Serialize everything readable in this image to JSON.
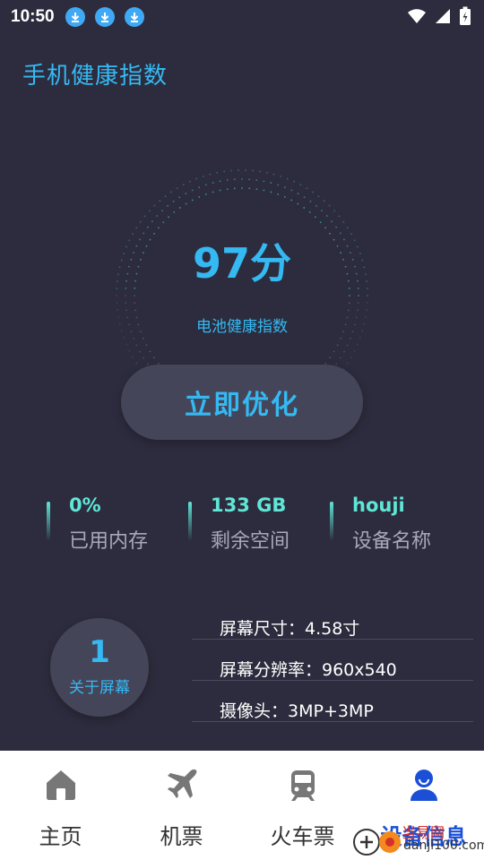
{
  "status": {
    "time": "10:50"
  },
  "header": {
    "title": "手机健康指数"
  },
  "score": {
    "value": "97分",
    "label": "电池健康指数"
  },
  "optimize_label": "立即优化",
  "stats": [
    {
      "value": "0%",
      "label": "已用内存"
    },
    {
      "value": "133 GB",
      "label": "剩余空间"
    },
    {
      "value": "houji",
      "label": "设备名称"
    }
  ],
  "screen": {
    "number": "1",
    "label": "关于屏幕",
    "info": [
      "屏幕尺寸：4.58寸",
      "屏幕分辨率：960x540",
      "摄像头：3MP+3MP"
    ]
  },
  "nav": [
    {
      "label": "主页",
      "icon": "home-icon"
    },
    {
      "label": "机票",
      "icon": "plane-icon"
    },
    {
      "label": "火车票",
      "icon": "train-icon"
    },
    {
      "label": "设备信息",
      "icon": "user-icon",
      "active": true
    }
  ],
  "watermark": {
    "site": "当易网",
    "url": "danji100.com"
  },
  "colors": {
    "accent": "#35b9f2",
    "teal": "#5fe6d6",
    "background": "#2d2c3e",
    "active_nav": "#1a4fd6"
  }
}
